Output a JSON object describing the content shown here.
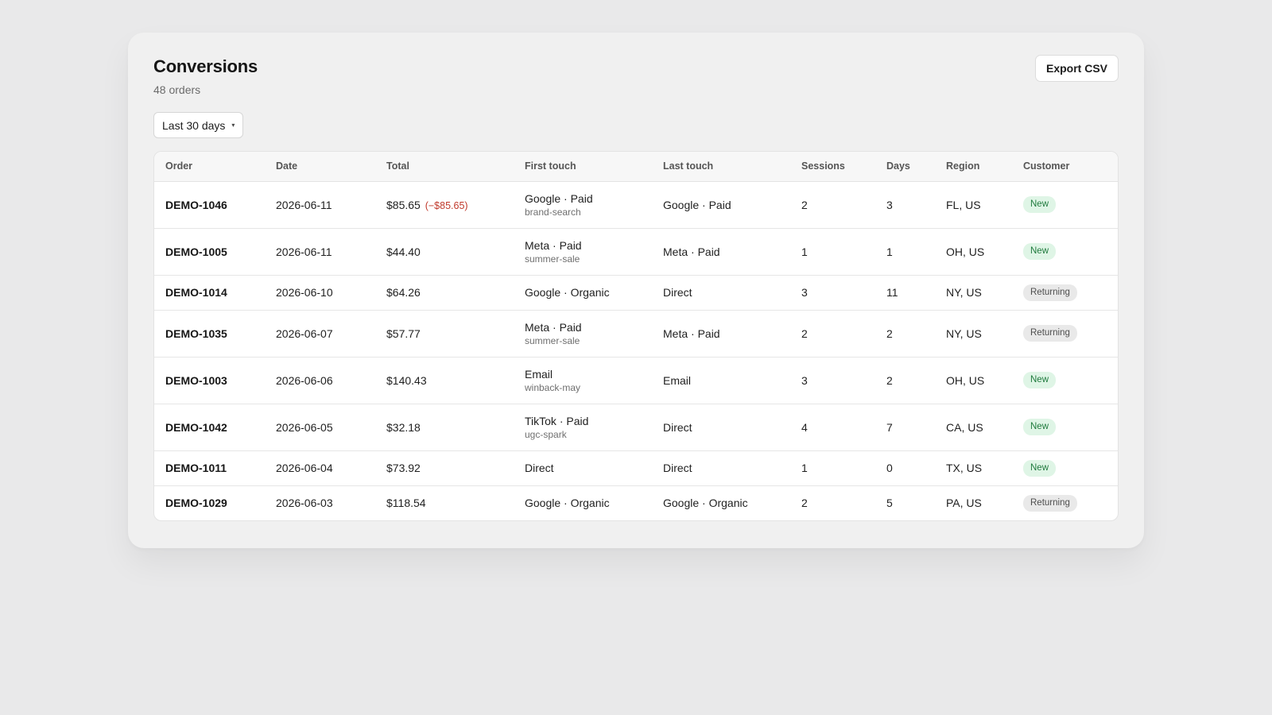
{
  "header": {
    "title": "Conversions",
    "subtitle": "48 orders",
    "export_label": "Export CSV"
  },
  "filter": {
    "date_range": "Last 30 days"
  },
  "table": {
    "columns": [
      "Order",
      "Date",
      "Total",
      "First touch",
      "Last touch",
      "Sessions",
      "Days",
      "Region",
      "Customer"
    ],
    "rows": [
      {
        "order": "DEMO-1046",
        "date": "2026-06-11",
        "total": "$85.65",
        "refund": "(−$85.65)",
        "first_touch": "Google · Paid",
        "first_touch_campaign": "brand-search",
        "last_touch": "Google · Paid",
        "sessions": "2",
        "days": "3",
        "region": "FL, US",
        "customer": "New"
      },
      {
        "order": "DEMO-1005",
        "date": "2026-06-11",
        "total": "$44.40",
        "refund": "",
        "first_touch": "Meta · Paid",
        "first_touch_campaign": "summer-sale",
        "last_touch": "Meta · Paid",
        "sessions": "1",
        "days": "1",
        "region": "OH, US",
        "customer": "New"
      },
      {
        "order": "DEMO-1014",
        "date": "2026-06-10",
        "total": "$64.26",
        "refund": "",
        "first_touch": "Google · Organic",
        "first_touch_campaign": "",
        "last_touch": "Direct",
        "sessions": "3",
        "days": "11",
        "region": "NY, US",
        "customer": "Returning"
      },
      {
        "order": "DEMO-1035",
        "date": "2026-06-07",
        "total": "$57.77",
        "refund": "",
        "first_touch": "Meta · Paid",
        "first_touch_campaign": "summer-sale",
        "last_touch": "Meta · Paid",
        "sessions": "2",
        "days": "2",
        "region": "NY, US",
        "customer": "Returning"
      },
      {
        "order": "DEMO-1003",
        "date": "2026-06-06",
        "total": "$140.43",
        "refund": "",
        "first_touch": "Email",
        "first_touch_campaign": "winback-may",
        "last_touch": "Email",
        "sessions": "3",
        "days": "2",
        "region": "OH, US",
        "customer": "New"
      },
      {
        "order": "DEMO-1042",
        "date": "2026-06-05",
        "total": "$32.18",
        "refund": "",
        "first_touch": "TikTok · Paid",
        "first_touch_campaign": "ugc-spark",
        "last_touch": "Direct",
        "sessions": "4",
        "days": "7",
        "region": "CA, US",
        "customer": "New"
      },
      {
        "order": "DEMO-1011",
        "date": "2026-06-04",
        "total": "$73.92",
        "refund": "",
        "first_touch": "Direct",
        "first_touch_campaign": "",
        "last_touch": "Direct",
        "sessions": "1",
        "days": "0",
        "region": "TX, US",
        "customer": "New"
      },
      {
        "order": "DEMO-1029",
        "date": "2026-06-03",
        "total": "$118.54",
        "refund": "",
        "first_touch": "Google · Organic",
        "first_touch_campaign": "",
        "last_touch": "Google · Organic",
        "sessions": "2",
        "days": "5",
        "region": "PA, US",
        "customer": "Returning"
      }
    ]
  },
  "colors": {
    "badge_new_bg": "#dff5e6",
    "badge_new_text": "#1f7a3d",
    "badge_returning_bg": "#e9e9e9",
    "refund_text": "#c0392b"
  }
}
